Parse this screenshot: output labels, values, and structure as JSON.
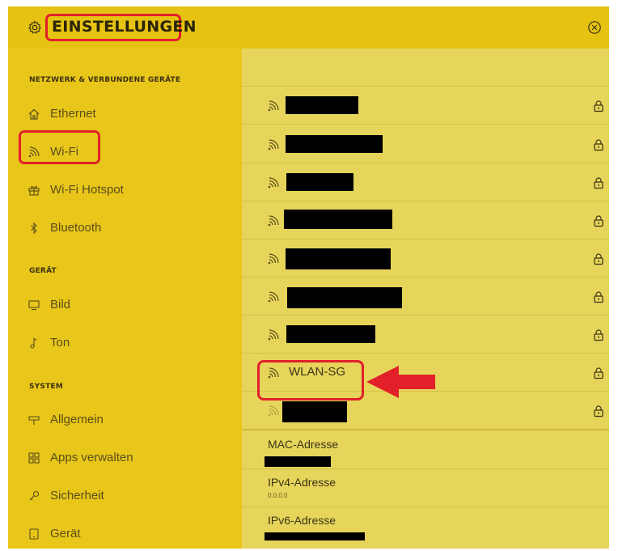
{
  "header": {
    "title": "EINSTELLUNGEN"
  },
  "sidebar": {
    "sections": [
      {
        "label": "NETZWERK & VERBUNDENE GERÄTE"
      },
      {
        "label": "GERÄT"
      },
      {
        "label": "SYSTEM"
      }
    ],
    "items": [
      {
        "label": "Ethernet",
        "icon": "home-icon"
      },
      {
        "label": "Wi-Fi",
        "icon": "wifi-icon"
      },
      {
        "label": "Wi-Fi Hotspot",
        "icon": "gift-icon"
      },
      {
        "label": "Bluetooth",
        "icon": "bluetooth-icon"
      },
      {
        "label": "Bild",
        "icon": "monitor-icon"
      },
      {
        "label": "Ton",
        "icon": "music-note-icon"
      },
      {
        "label": "Allgemein",
        "icon": "signpost-icon"
      },
      {
        "label": "Apps verwalten",
        "icon": "grid-icon"
      },
      {
        "label": "Sicherheit",
        "icon": "key-icon"
      },
      {
        "label": "Gerät",
        "icon": "device-icon"
      }
    ]
  },
  "networks": {
    "highlighted": {
      "name": "WLAN-SG"
    }
  },
  "info": {
    "mac_label": "MAC-Adresse",
    "ipv4_label": "IPv4-Adresse",
    "ipv4_value": "0.0.0.0",
    "ipv6_label": "IPv6-Adresse"
  },
  "colors": {
    "background": "#e9c61a",
    "main_panel": "#e6d55a",
    "highlight_red": "#e2202a"
  }
}
